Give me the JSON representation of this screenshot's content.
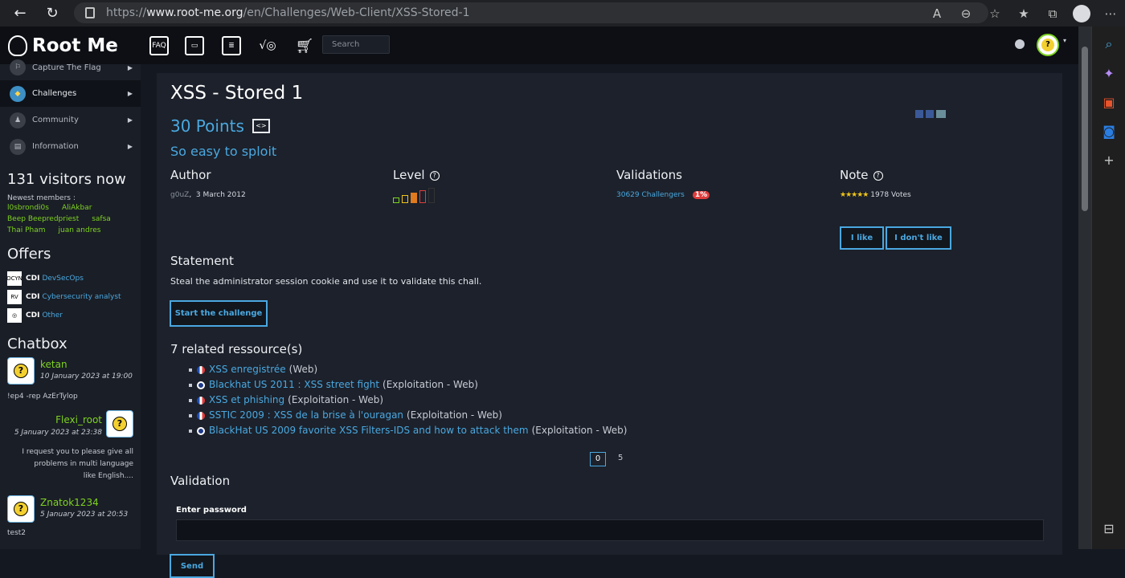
{
  "browser": {
    "url_prefix": "https://",
    "url_domain": "www.root-me.org",
    "url_path": "/en/Challenges/Web-Client/XSS-Stored-1"
  },
  "site": {
    "logo": "Root Me",
    "search_placeholder": "Search",
    "menu": [
      {
        "label": "Capture The Flag",
        "icon": "flag-icon"
      },
      {
        "label": "Challenges",
        "icon": "challenges-icon",
        "active": true
      },
      {
        "label": "Community",
        "icon": "community-icon"
      },
      {
        "label": "Information",
        "icon": "information-icon"
      }
    ],
    "visitors": "131 visitors now",
    "newest_label": "Newest members :",
    "members": [
      "l0sbrondi0s",
      "AliAkbar",
      "Beep Beep",
      "redpriest",
      "safsa",
      "Thai Pham",
      "juan andres"
    ],
    "offers_title": "Offers",
    "offers": [
      {
        "logo": "OCYN",
        "type": "CDI",
        "label": "DevSecOps"
      },
      {
        "logo": "RV",
        "type": "CDI",
        "label": "Cybersecurity analyst"
      },
      {
        "logo": "◎",
        "type": "CDI",
        "label": "Other"
      }
    ],
    "chatbox_title": "Chatbox",
    "chats": [
      {
        "name": "ketan",
        "date": "10 January 2023 at 19:00",
        "msg": "!ep4 -rep AzErTylop"
      },
      {
        "name": "Flexi_root",
        "date": "5 January 2023 at 23:38",
        "msg": "I request you to please give all problems in multi language like English...."
      },
      {
        "name": "Znatok1234",
        "date": "5 January 2023 at 20:53",
        "msg": "test2"
      }
    ]
  },
  "challenge": {
    "title": "XSS - Stored 1",
    "points": "30 Points",
    "subtitle": "So easy to sploit",
    "author_h": "Author",
    "author": "g0uZ",
    "date": "3 March 2012",
    "level_h": "Level",
    "level": 3,
    "validations_h": "Validations",
    "challengers": "30629 Challengers",
    "pct": "1%",
    "note_h": "Note",
    "votes": "1978 Votes",
    "like": "I like",
    "dislike": "I don't like",
    "statement_h": "Statement",
    "statement": "Steal the administrator session cookie and use it to validate this chall.",
    "start": "Start the challenge",
    "resources_h": "7 related ressource(s)",
    "resources": [
      {
        "flag": "fr",
        "link": "XSS enregistrée",
        "cat": "(Web)"
      },
      {
        "flag": "uk",
        "link": "Blackhat US 2011 : XSS street fight",
        "cat": "(Exploitation - Web)"
      },
      {
        "flag": "fr",
        "link": "XSS et phishing",
        "cat": "(Exploitation - Web)"
      },
      {
        "flag": "fr",
        "link": "SSTIC 2009 : XSS de la brise à l'ouragan",
        "cat": "(Exploitation - Web)"
      },
      {
        "flag": "uk",
        "link": "BlackHat US 2009 favorite XSS Filters-IDS and how to attack them",
        "cat": "(Exploitation - Web)"
      }
    ],
    "pager_current": "0",
    "pager_other": "5",
    "validation_h": "Validation",
    "password_label": "Enter password",
    "send": "Send"
  },
  "colors": {
    "accent": "#4aa8e0",
    "green": "#7ed321",
    "bg": "#141821"
  }
}
